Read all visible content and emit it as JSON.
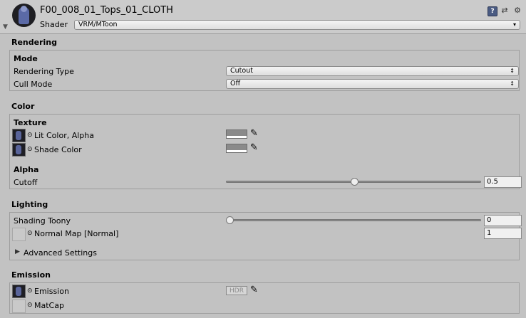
{
  "header": {
    "title": "F00_008_01_Tops_01_CLOTH",
    "shader_label": "Shader",
    "shader_value": "VRM/MToon",
    "help_icon_text": "?",
    "icons": [
      "help-icon",
      "preset-icon",
      "gear-icon"
    ]
  },
  "rendering": {
    "section_title": "Rendering",
    "mode_title": "Mode",
    "rendering_type_label": "Rendering Type",
    "rendering_type_value": "Cutout",
    "cull_mode_label": "Cull Mode",
    "cull_mode_value": "Off"
  },
  "color": {
    "section_title": "Color",
    "texture_title": "Texture",
    "lit_color_label": "Lit Color, Alpha",
    "shade_color_label": "Shade Color",
    "alpha_title": "Alpha",
    "cutoff_label": "Cutoff",
    "cutoff_value": "0.5",
    "cutoff_fraction": 0.5
  },
  "lighting": {
    "section_title": "Lighting",
    "shading_toony_label": "Shading Toony",
    "shading_toony_value": "0",
    "shading_toony_fraction": 0,
    "normal_map_label": "Normal Map [Normal]",
    "normal_map_value": "1",
    "advanced_label": "Advanced Settings"
  },
  "emission": {
    "section_title": "Emission",
    "emission_label": "Emission",
    "hdr_label": "HDR",
    "matcap_label": "MatCap"
  },
  "colors": {
    "background": "#c2c2c2",
    "swatch": "#8a8a8a"
  }
}
